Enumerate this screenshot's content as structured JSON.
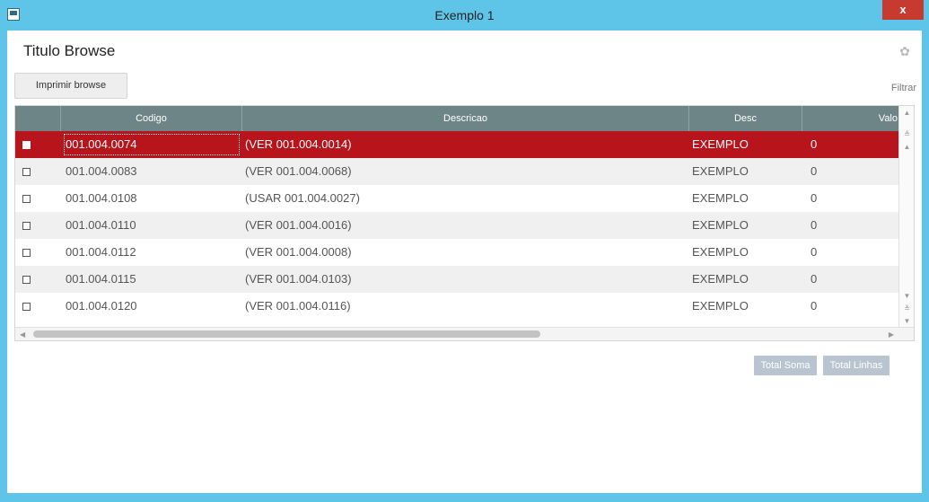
{
  "window": {
    "title": "Exemplo 1",
    "close_label": "x"
  },
  "browse": {
    "title": "Titulo Browse",
    "print_label": "Imprimir browse",
    "filter_label": "Filtrar"
  },
  "columns": [
    "",
    "Codigo",
    "Descricao",
    "Desc",
    "Valo"
  ],
  "rows": [
    {
      "codigo": "001.004.0074",
      "descricao": "(VER 001.004.0014)",
      "desc": "EXEMPLO",
      "valor": "0",
      "selected": true
    },
    {
      "codigo": "001.004.0083",
      "descricao": "(VER 001.004.0068)",
      "desc": "EXEMPLO",
      "valor": "0",
      "selected": false
    },
    {
      "codigo": "001.004.0108",
      "descricao": "(USAR 001.004.0027)",
      "desc": "EXEMPLO",
      "valor": "0",
      "selected": false
    },
    {
      "codigo": "001.004.0110",
      "descricao": "(VER 001.004.0016)",
      "desc": "EXEMPLO",
      "valor": "0",
      "selected": false
    },
    {
      "codigo": "001.004.0112",
      "descricao": "(VER 001.004.0008)",
      "desc": "EXEMPLO",
      "valor": "0",
      "selected": false
    },
    {
      "codigo": "001.004.0115",
      "descricao": "(VER 001.004.0103)",
      "desc": "EXEMPLO",
      "valor": "0",
      "selected": false
    },
    {
      "codigo": "001.004.0120",
      "descricao": "(VER 001.004.0116)",
      "desc": "EXEMPLO",
      "valor": "0",
      "selected": false
    }
  ],
  "footer": {
    "total_soma": "Total Soma",
    "total_linhas": "Total Linhas"
  },
  "icons": {
    "window": "window-icon",
    "settings": "gear-icon"
  },
  "colors": {
    "titlebar": "#5fc5e8",
    "selected_row": "#b7141b",
    "header": "#6e8587",
    "close": "#c73a2f"
  }
}
